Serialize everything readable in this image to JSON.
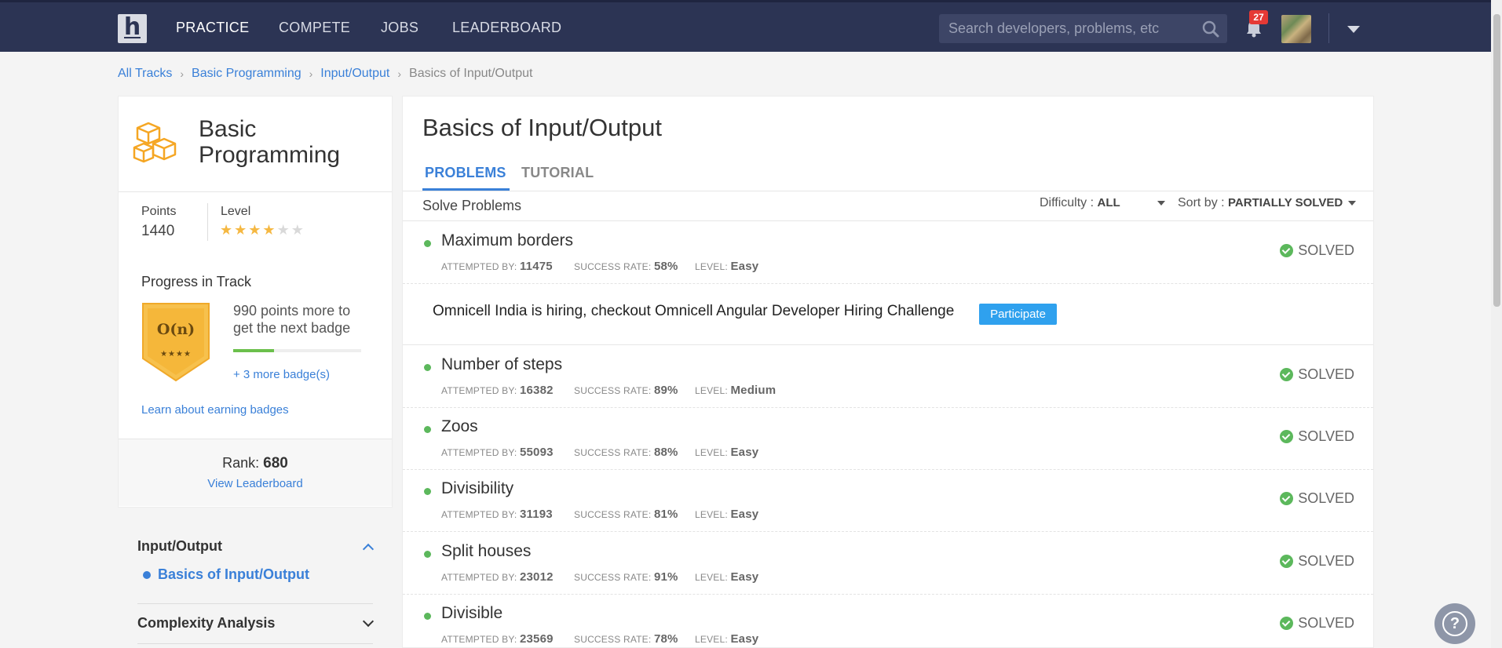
{
  "nav": {
    "logo": "h",
    "items": [
      "PRACTICE",
      "COMPETE",
      "JOBS",
      "LEADERBOARD"
    ],
    "search_placeholder": "Search developers, problems, etc",
    "notification_count": "27"
  },
  "breadcrumb": [
    "All Tracks",
    "Basic Programming",
    "Input/Output",
    "Basics of Input/Output"
  ],
  "track": {
    "title": "Basic Programming",
    "points_label": "Points",
    "points": "1440",
    "level_label": "Level",
    "level_stars": 4,
    "level_max": 6,
    "progress_label": "Progress in Track",
    "badge_text": "O(n)",
    "badge_stars": "★★★★",
    "next_badge": "990 points more to get the next badge",
    "progress_fraction": 0.32,
    "more_badges": "+ 3 more badge(s)",
    "learn": "Learn about earning badges",
    "rank_label": "Rank:",
    "rank": "680",
    "view_leaderboard": "View Leaderboard"
  },
  "sidebar": {
    "sections": [
      {
        "label": "Input/Output",
        "expanded": true,
        "items": [
          "Basics of Input/Output"
        ]
      },
      {
        "label": "Complexity Analysis",
        "expanded": false
      }
    ]
  },
  "main": {
    "title": "Basics of Input/Output",
    "tabs": [
      "PROBLEMS",
      "TUTORIAL"
    ],
    "solve_label": "Solve Problems",
    "difficulty_label": "Difficulty :",
    "difficulty_value": "ALL",
    "sort_label": "Sort by :",
    "sort_value": "PARTIALLY SOLVED",
    "meta_labels": {
      "attempted": "ATTEMPTED BY:",
      "success": "SUCCESS RATE:",
      "level": "LEVEL:"
    },
    "status_label": "SOLVED",
    "ad": {
      "text": "Omnicell India is hiring, checkout Omnicell Angular Developer Hiring Challenge",
      "button": "Participate"
    },
    "problems": [
      {
        "title": "Maximum borders",
        "attempted": "11475",
        "success": "58%",
        "level": "Easy",
        "status": "SOLVED"
      },
      {
        "title": "Number of steps",
        "attempted": "16382",
        "success": "89%",
        "level": "Medium",
        "status": "SOLVED"
      },
      {
        "title": "Zoos",
        "attempted": "55093",
        "success": "88%",
        "level": "Easy",
        "status": "SOLVED"
      },
      {
        "title": "Divisibility",
        "attempted": "31193",
        "success": "81%",
        "level": "Easy",
        "status": "SOLVED"
      },
      {
        "title": "Split houses",
        "attempted": "23012",
        "success": "91%",
        "level": "Easy",
        "status": "SOLVED"
      },
      {
        "title": "Divisible",
        "attempted": "23569",
        "success": "78%",
        "level": "Easy",
        "status": "SOLVED"
      }
    ]
  },
  "help": "?"
}
